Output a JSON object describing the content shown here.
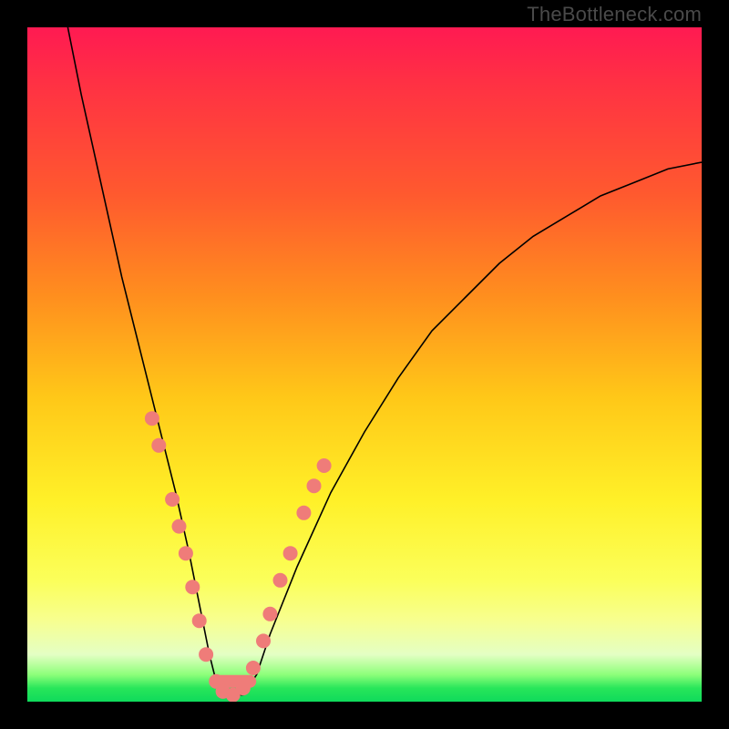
{
  "watermark": "TheBottleneck.com",
  "chart_data": {
    "type": "line",
    "title": "",
    "xlabel": "",
    "ylabel": "",
    "xlim": [
      0,
      100
    ],
    "ylim": [
      0,
      100
    ],
    "grid": false,
    "legend": false,
    "annotations": [],
    "series": [
      {
        "name": "curve",
        "x": [
          6,
          8,
          10,
          12,
          14,
          16,
          18,
          20,
          22,
          24,
          25,
          26,
          27,
          28,
          30,
          32,
          34,
          36,
          40,
          45,
          50,
          55,
          60,
          65,
          70,
          75,
          80,
          85,
          90,
          95,
          100
        ],
        "y": [
          100,
          90,
          81,
          72,
          63,
          55,
          47,
          39,
          31,
          22,
          17,
          12,
          7,
          3,
          1,
          1,
          4,
          10,
          20,
          31,
          40,
          48,
          55,
          60,
          65,
          69,
          72,
          75,
          77,
          79,
          80
        ]
      }
    ],
    "markers": [
      {
        "x": 18.5,
        "y": 42
      },
      {
        "x": 19.5,
        "y": 38
      },
      {
        "x": 21.5,
        "y": 30
      },
      {
        "x": 22.5,
        "y": 26
      },
      {
        "x": 23.5,
        "y": 22
      },
      {
        "x": 24.5,
        "y": 17
      },
      {
        "x": 25.5,
        "y": 12
      },
      {
        "x": 26.5,
        "y": 7
      },
      {
        "x": 28,
        "y": 3
      },
      {
        "x": 29,
        "y": 1.5
      },
      {
        "x": 30.5,
        "y": 1
      },
      {
        "x": 32,
        "y": 2
      },
      {
        "x": 33.5,
        "y": 5
      },
      {
        "x": 35,
        "y": 9
      },
      {
        "x": 36,
        "y": 13
      },
      {
        "x": 37.5,
        "y": 18
      },
      {
        "x": 39,
        "y": 22
      },
      {
        "x": 41,
        "y": 28
      },
      {
        "x": 42.5,
        "y": 32
      },
      {
        "x": 44,
        "y": 35
      }
    ],
    "segments": [
      {
        "x1": 28,
        "y1": 3,
        "x2": 33,
        "y2": 3
      }
    ]
  }
}
